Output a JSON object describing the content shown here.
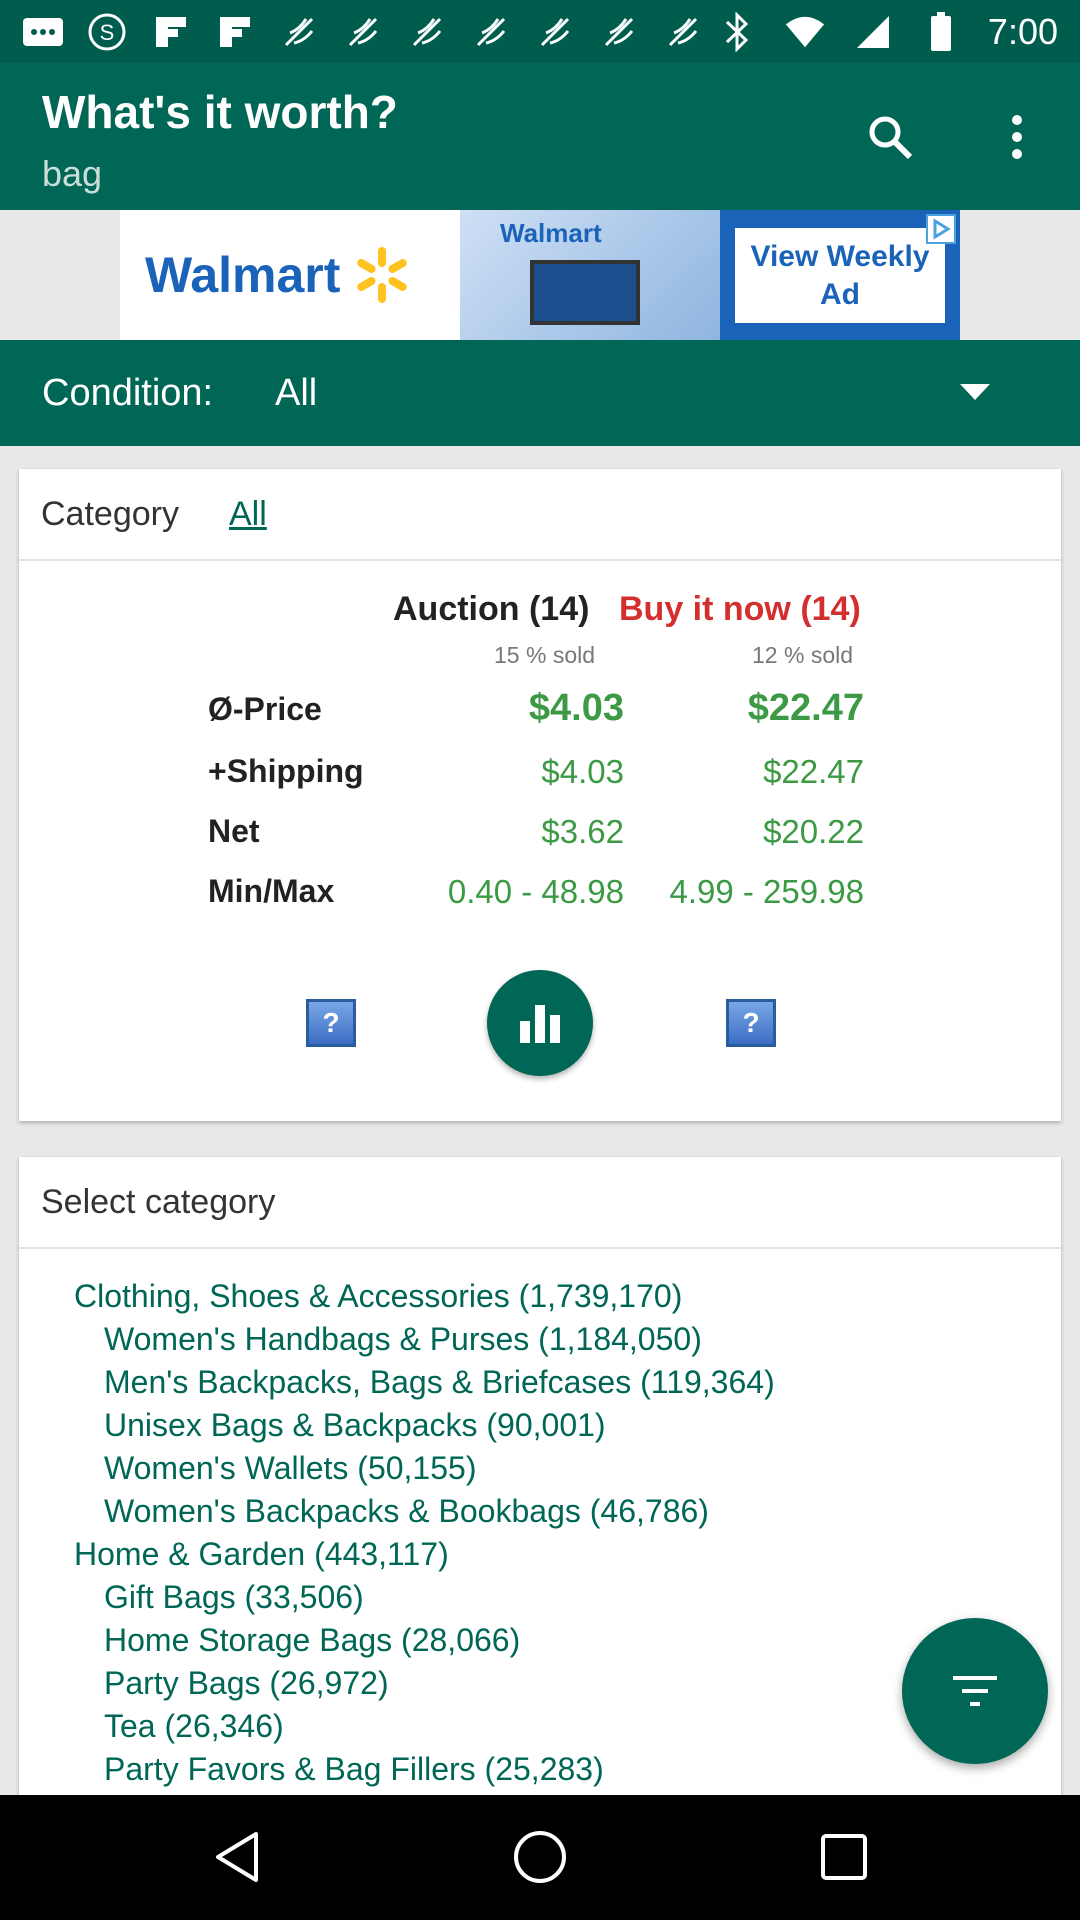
{
  "status_bar": {
    "time": "7:00",
    "left_icons": [
      "message-icon",
      "sync-icon",
      "flipboard-icon",
      "flipboard-icon",
      "snapdragon-icon",
      "snapdragon-icon",
      "snapdragon-icon",
      "snapdragon-icon",
      "snapdragon-icon",
      "snapdragon-icon",
      "snapdragon-icon"
    ],
    "right_icons": [
      "bluetooth-icon",
      "wifi-icon",
      "signal-icon",
      "battery-icon"
    ]
  },
  "app_bar": {
    "title": "What's it worth?",
    "subtitle": "bag",
    "actions": [
      "search-icon",
      "more-vert-icon"
    ]
  },
  "ad": {
    "brand": "Walmart",
    "mid_brand": "Walmart",
    "cta": "View Weekly Ad",
    "colors": {
      "brand_blue": "#1a63b9",
      "spark_yellow": "#ffc220"
    }
  },
  "condition": {
    "label": "Condition:",
    "value": "All"
  },
  "summary_card": {
    "category_label": "Category",
    "category_value": "All",
    "auction_header": "Auction (14)",
    "buynow_header": "Buy it now (14)",
    "auction_sold": "15 % sold",
    "buynow_sold": "12 % sold",
    "rows": [
      {
        "label": "Ø-Price",
        "auction": "$4.03",
        "buynow": "$22.47"
      },
      {
        "label": "+Shipping",
        "auction": "$4.03",
        "buynow": "$22.47"
      },
      {
        "label": "Net",
        "auction": "$3.62",
        "buynow": "$20.22"
      },
      {
        "label": "Min/Max",
        "auction": "0.40 - 48.98",
        "buynow": "4.99 - 259.98"
      }
    ],
    "help_symbol": "?"
  },
  "select_category": {
    "title": "Select category",
    "items": [
      {
        "text": "Clothing, Shoes & Accessories (1,739,170)",
        "level": 0
      },
      {
        "text": "Women's Handbags & Purses (1,184,050)",
        "level": 1
      },
      {
        "text": "Men's Backpacks, Bags & Briefcases (119,364)",
        "level": 1
      },
      {
        "text": "Unisex Bags & Backpacks (90,001)",
        "level": 1
      },
      {
        "text": "Women's Wallets (50,155)",
        "level": 1
      },
      {
        "text": "Women's Backpacks & Bookbags (46,786)",
        "level": 1
      },
      {
        "text": "Home & Garden (443,117)",
        "level": 0
      },
      {
        "text": "Gift Bags (33,506)",
        "level": 1
      },
      {
        "text": "Home Storage Bags (28,066)",
        "level": 1
      },
      {
        "text": "Party Bags (26,972)",
        "level": 1
      },
      {
        "text": "Tea (26,346)",
        "level": 1
      },
      {
        "text": "Party Favors & Bag Fillers (25,283)",
        "level": 1
      }
    ]
  },
  "colors": {
    "primary": "#006655",
    "status_bar": "#005c4c",
    "price_green": "#3c9a45",
    "buynow_red": "#d32f2f"
  }
}
